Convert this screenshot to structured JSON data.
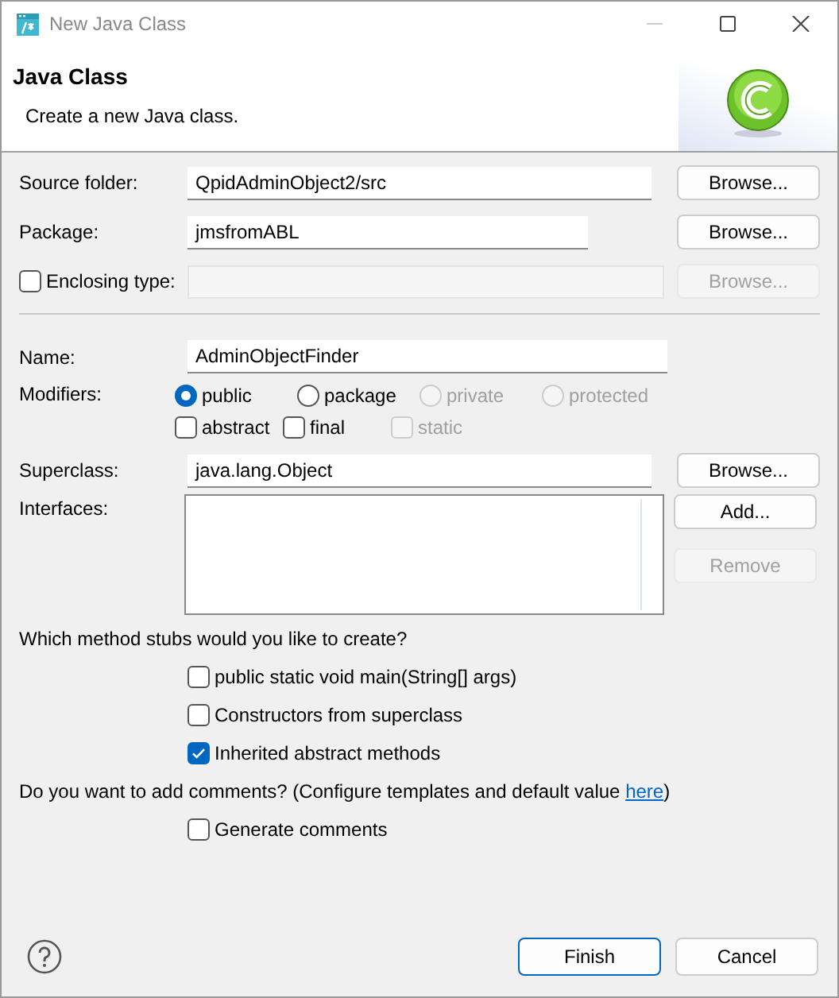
{
  "window": {
    "title": "New Java Class"
  },
  "header": {
    "title": "Java Class",
    "description": "Create a new Java class."
  },
  "source_folder": {
    "label": "Source folder:",
    "value": "QpidAdminObject2/src",
    "button": {
      "label": "Browse...",
      "disabled": false
    }
  },
  "package": {
    "label": "Package:",
    "value": "jmsfromABL",
    "button": {
      "label": "Browse...",
      "disabled": false
    }
  },
  "enclosing_type": {
    "label": "Enclosing type:",
    "checked": false,
    "button": {
      "label": "Browse...",
      "disabled": true
    }
  },
  "name": {
    "label": "Name:",
    "value": "AdminObjectFinder"
  },
  "modifiers": {
    "label": "Modifiers:",
    "visibility": [
      {
        "label": "public",
        "selected": true,
        "disabled": false
      },
      {
        "label": "package",
        "selected": false,
        "disabled": false
      },
      {
        "label": "private",
        "selected": false,
        "disabled": true
      },
      {
        "label": "protected",
        "selected": false,
        "disabled": true
      }
    ],
    "options": [
      {
        "label": "abstract",
        "checked": false,
        "disabled": false
      },
      {
        "label": "final",
        "checked": false,
        "disabled": false
      },
      {
        "label": "static",
        "checked": false,
        "disabled": true
      }
    ]
  },
  "superclass": {
    "label": "Superclass:",
    "value": "java.lang.Object",
    "button": {
      "label": "Browse...",
      "disabled": false
    }
  },
  "interfaces": {
    "label": "Interfaces:",
    "buttons": [
      {
        "label": "Add...",
        "disabled": false
      },
      {
        "label": "Remove",
        "disabled": true
      }
    ]
  },
  "method_stubs": {
    "question": "Which method stubs would you like to create?",
    "options": [
      {
        "label": "public static void main(String[] args)",
        "checked": false
      },
      {
        "label": "Constructors from superclass",
        "checked": false
      },
      {
        "label": "Inherited abstract methods",
        "checked": true
      }
    ]
  },
  "comments": {
    "question": "Do you want to add comments? (Configure templates and default value ",
    "link": "here",
    "suffix": ")",
    "options": [
      {
        "label": "Generate comments",
        "checked": false
      }
    ]
  },
  "buttons": [
    {
      "label": "Finish",
      "default": true
    },
    {
      "label": "Cancel",
      "default": false
    }
  ]
}
